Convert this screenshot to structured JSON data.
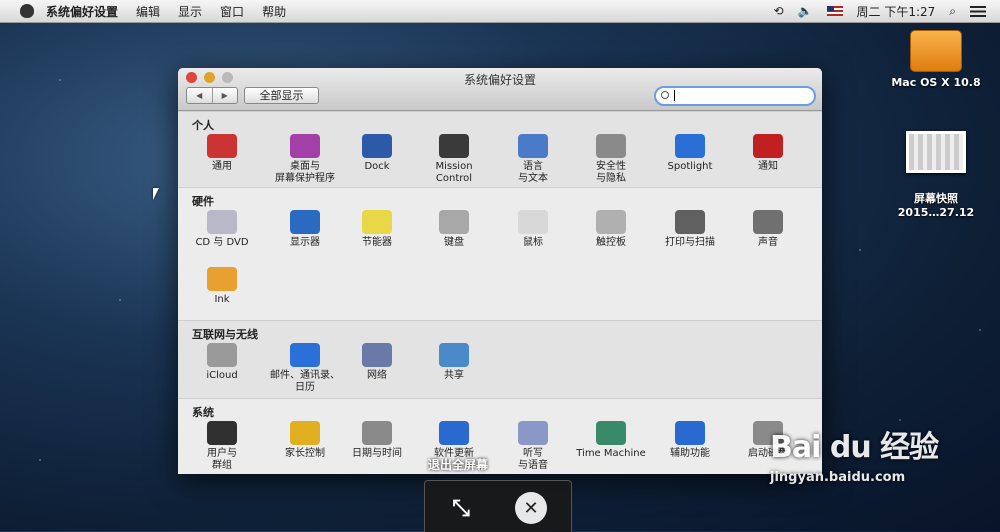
{
  "menubar": {
    "app": "系统偏好设置",
    "items": [
      "编辑",
      "显示",
      "窗口",
      "帮助"
    ],
    "clock": "周二 下午1:27"
  },
  "desktop": [
    {
      "label": "Mac OS X 10.8"
    },
    {
      "label": "屏幕快照\n2015…27.12"
    }
  ],
  "window": {
    "title": "系统偏好设置",
    "nav_back": "◀",
    "nav_fwd": "▶",
    "show_all": "全部显示",
    "search_value": ""
  },
  "sections": [
    {
      "title": "个人",
      "panes": [
        {
          "label": "通用",
          "icon": "general-icon",
          "color": "#cc3333"
        },
        {
          "label": "桌面与\n屏幕保护程序",
          "icon": "desktop-icon",
          "color": "#a340a8"
        },
        {
          "label": "Dock",
          "icon": "dock-icon",
          "color": "#2d5aa8"
        },
        {
          "label": "Mission\nControl",
          "icon": "mission-control-icon",
          "color": "#3a3a3a"
        },
        {
          "label": "语言\n与文本",
          "icon": "language-icon",
          "color": "#4a7ac8"
        },
        {
          "label": "安全性\n与隐私",
          "icon": "security-icon",
          "color": "#8a8a8a"
        },
        {
          "label": "Spotlight",
          "icon": "spotlight-icon",
          "color": "#2a6fd6"
        },
        {
          "label": "通知",
          "icon": "notification-icon",
          "color": "#c02020"
        }
      ]
    },
    {
      "title": "硬件",
      "panes": [
        {
          "label": "CD 与 DVD",
          "icon": "cd-dvd-icon",
          "color": "#b8b8c8"
        },
        {
          "label": "显示器",
          "icon": "display-icon",
          "color": "#2a6ac0"
        },
        {
          "label": "节能器",
          "icon": "energy-saver-icon",
          "color": "#e8d848"
        },
        {
          "label": "键盘",
          "icon": "keyboard-icon",
          "color": "#a8a8a8"
        },
        {
          "label": "鼠标",
          "icon": "mouse-icon",
          "color": "#d8d8d8"
        },
        {
          "label": "触控板",
          "icon": "trackpad-icon",
          "color": "#b0b0b0"
        },
        {
          "label": "打印与扫描",
          "icon": "printer-icon",
          "color": "#606060"
        },
        {
          "label": "声音",
          "icon": "sound-icon",
          "color": "#707070"
        },
        {
          "label": "Ink",
          "icon": "ink-icon",
          "color": "#e8a030"
        }
      ]
    },
    {
      "title": "互联网与无线",
      "panes": [
        {
          "label": "iCloud",
          "icon": "icloud-icon",
          "color": "#9a9a9a"
        },
        {
          "label": "邮件、通讯录、\n日历",
          "icon": "mail-icon",
          "color": "#2a70d8"
        },
        {
          "label": "网络",
          "icon": "network-icon",
          "color": "#6a7aa8"
        },
        {
          "label": "共享",
          "icon": "sharing-icon",
          "color": "#4a8ac8"
        }
      ]
    },
    {
      "title": "系统",
      "panes": [
        {
          "label": "用户与\n群组",
          "icon": "users-icon",
          "color": "#303030"
        },
        {
          "label": "家长控制",
          "icon": "parental-control-icon",
          "color": "#e0b020"
        },
        {
          "label": "日期与时间",
          "icon": "date-time-icon",
          "color": "#8a8a8a"
        },
        {
          "label": "软件更新",
          "icon": "software-update-icon",
          "color": "#2a6ad0"
        },
        {
          "label": "听写\n与语音",
          "icon": "dictation-icon",
          "color": "#8a98c8"
        },
        {
          "label": "Time Machine",
          "icon": "time-machine-icon",
          "color": "#3a8a6a"
        },
        {
          "label": "辅助功能",
          "icon": "accessibility-icon",
          "color": "#2a6ad0"
        },
        {
          "label": "启动磁盘",
          "icon": "startup-disk-icon",
          "color": "#8a8a8a"
        }
      ]
    }
  ],
  "overlay": {
    "label": "退出全屏幕"
  },
  "watermark": {
    "brand": "Bai du 经验",
    "url": "jingyan.baidu.com"
  }
}
